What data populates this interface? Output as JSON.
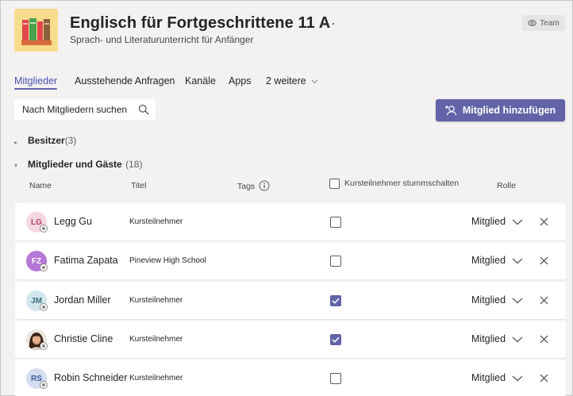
{
  "header": {
    "title": "Englisch für Fortgeschrittene 11 A",
    "more_label": "···",
    "subtitle": "Sprach- und Literaturunterricht für Anfänger",
    "badge": "Team"
  },
  "tabs": [
    {
      "label": "Mitglieder",
      "active": true
    },
    {
      "label": "Ausstehende Anfragen",
      "active": false
    },
    {
      "label": "Kanäle",
      "active": false
    },
    {
      "label": "Apps",
      "active": false
    },
    {
      "label": "2 weitere",
      "active": false
    }
  ],
  "search": {
    "placeholder": "Nach Mitgliedern suchen"
  },
  "add_member_label": "Mitglied hinzufügen",
  "sections": {
    "owners": {
      "title": "Besitzer",
      "count": "(3)"
    },
    "members": {
      "title": "Mitglieder und Gäste",
      "count": "(18)"
    }
  },
  "columns": {
    "name": "Name",
    "title": "Titel",
    "tags": "Tags",
    "mute": "Kursteilnehmer stummschalten",
    "role": "Rolle"
  },
  "members": [
    {
      "initials": "LG",
      "name": "Legg Gu",
      "title": "Kursteilnehmer",
      "muted": false,
      "role": "Mitglied",
      "avatar_bg": "#f5d7e0",
      "avatar_fg": "#b0406b"
    },
    {
      "initials": "FZ",
      "name": "Fatima Zapata",
      "title": "Pineview High School",
      "muted": false,
      "role": "Mitglied",
      "avatar_bg": "#b577d8",
      "avatar_fg": "#ffffff"
    },
    {
      "initials": "JM",
      "name": "Jordan Miller",
      "title": "Kursteilnehmer",
      "muted": true,
      "role": "Mitglied",
      "avatar_bg": "#d2e6ec",
      "avatar_fg": "#3c6e7a"
    },
    {
      "initials": "",
      "name": "Christie Cline",
      "title": "Kursteilnehmer",
      "muted": true,
      "role": "Mitglied",
      "avatar_bg": "#4a3326",
      "avatar_fg": "#ffffff"
    },
    {
      "initials": "RS",
      "name": "Robin Schneider",
      "title": "Kursteilnehmer",
      "muted": false,
      "role": "Mitglied",
      "avatar_bg": "#d4ddf0",
      "avatar_fg": "#3b5a99"
    }
  ],
  "colors": {
    "accent": "#6264a7",
    "active_tab": "#4f52b2",
    "background": "#f3f2f1"
  }
}
